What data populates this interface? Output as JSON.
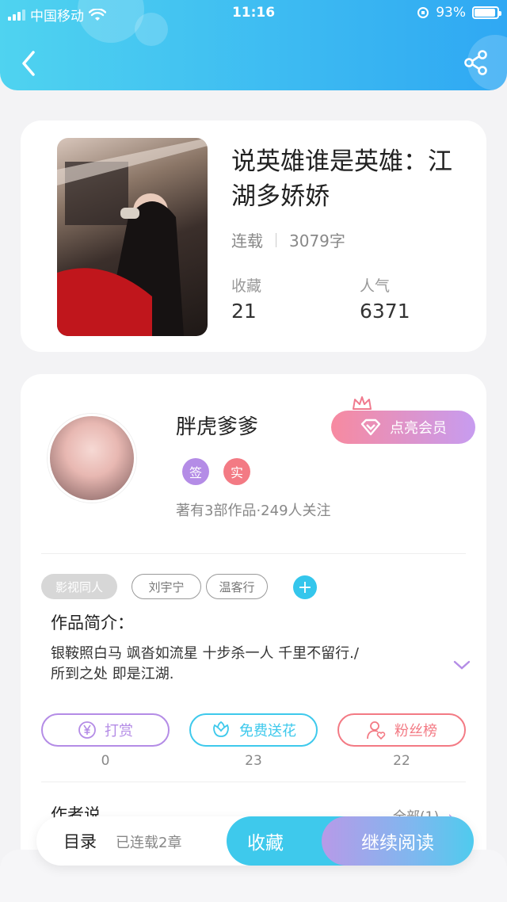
{
  "status_bar": {
    "carrier": "中国移动",
    "time": "11:16",
    "battery": "93%"
  },
  "book": {
    "title": "说英雄谁是英雄：江湖多娇娇",
    "status": "连载",
    "word_count": "3079字",
    "favorites_label": "收藏",
    "favorites_value": "21",
    "popularity_label": "人气",
    "popularity_value": "6371"
  },
  "author": {
    "name": "胖虎爹爹",
    "vip_label": "点亮会员",
    "badge_sign": "签",
    "badge_real": "实",
    "info": "著有3部作品·249人关注"
  },
  "tags": [
    "影视同人",
    "刘宇宁",
    "温客行"
  ],
  "intro": {
    "title": "作品简介：",
    "text_line1": "银鞍照白马 飒沓如流星 十步杀一人 千里不留行./",
    "text_line2": "所到之处 即是江湖."
  },
  "actions": [
    {
      "label": "打赏",
      "count": "0"
    },
    {
      "label": "免费送花",
      "count": "23"
    },
    {
      "label": "粉丝榜",
      "count": "22"
    }
  ],
  "author_say": {
    "title": "作者说",
    "all": "全部(1)"
  },
  "bottom": {
    "toc": "目录",
    "toc_sub": "已连载2章",
    "favorite": "收藏",
    "continue": "继续阅读"
  },
  "colors": {
    "header_start": "#4fd3f0",
    "header_end": "#2fa8f3",
    "accent": "#3ec9ec"
  }
}
